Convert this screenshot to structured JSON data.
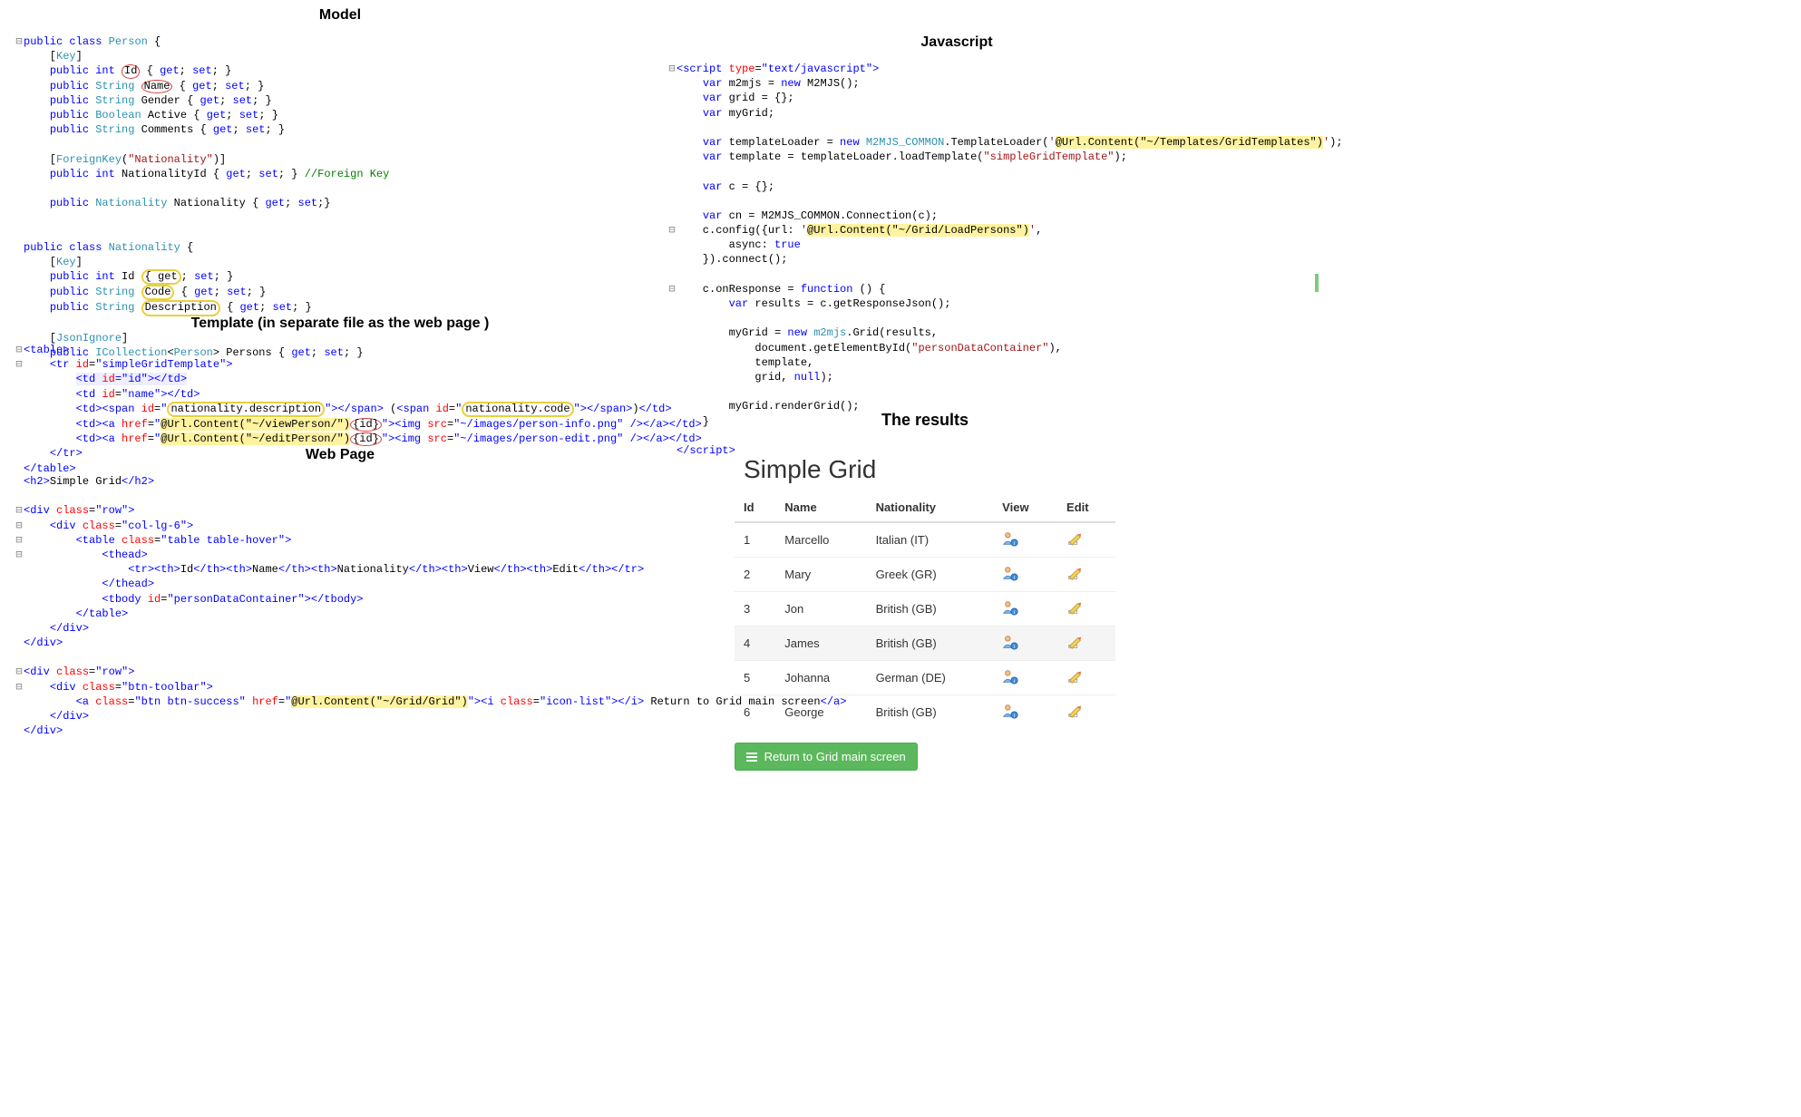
{
  "headings": {
    "model": "Model",
    "template": "Template (in separate file as the web page )",
    "webpage": "Web Page",
    "javascript": "Javascript",
    "results": "The results"
  },
  "model_code": {
    "person_class": "Person",
    "nationality_class": "Nationality",
    "key_attr": "[Key]",
    "fk_attr": "[ForeignKey(\"Nationality\")]",
    "jsonignore_attr": "[JsonIgnore]",
    "fk_comment": "//Foreign Key",
    "props_person": {
      "id": "Id",
      "name": "Name",
      "gender": "Gender",
      "active": "Active",
      "comments": "Comments",
      "nationalityid": "NationalityId",
      "nationality": "Nationality"
    },
    "props_nat": {
      "id": "Id",
      "code": "Code",
      "description": "Description",
      "persons": "Persons"
    }
  },
  "template_code": {
    "tr_id": "simpleGridTemplate",
    "td_id_id": "id",
    "td_id_name": "name",
    "span_natdesc": "nationality.description",
    "span_natcode": "nationality.code",
    "view_url": "@Url.Content(\"~/viewPerson/\"){id}",
    "edit_url": "@Url.Content(\"~/editPerson/\"){id}",
    "img_view": "~/images/person-info.png",
    "img_edit": "~/images/person-edit.png"
  },
  "webpage_code": {
    "h2_text": "Simple Grid",
    "row_class": "row",
    "col_class": "col-lg-6",
    "table_class": "table table-hover",
    "th_cols": [
      "Id",
      "Name",
      "Nationality",
      "View",
      "Edit"
    ],
    "tbody_id": "personDataContainer",
    "toolbar_class": "btn-toolbar",
    "btn_class": "btn btn-success",
    "btn_href": "@Url.Content(\"~/Grid/Grid\")",
    "icon_class": "icon-list",
    "btn_text": " Return to Grid main screen"
  },
  "js_code": {
    "script_type": "text/javascript",
    "m2mjs_new": "new M2MJS();",
    "tpl_url": "@Url.Content(\"~/Templates/GridTemplates\")",
    "tpl_name": "simpleGridTemplate",
    "conn_url": "@Url.Content(\"~/Grid/LoadPersons\")",
    "async_true": "true",
    "container_id": "personDataContainer",
    "m2mjs_grid": "m2mjs"
  },
  "results_grid": {
    "title": "Simple Grid",
    "columns": [
      "Id",
      "Name",
      "Nationality",
      "View",
      "Edit"
    ],
    "rows": [
      {
        "id": "1",
        "name": "Marcello",
        "nationality": "Italian (IT)"
      },
      {
        "id": "2",
        "name": "Mary",
        "nationality": "Greek (GR)"
      },
      {
        "id": "3",
        "name": "Jon",
        "nationality": "British (GB)"
      },
      {
        "id": "4",
        "name": "James",
        "nationality": "British (GB)",
        "hovered": true
      },
      {
        "id": "5",
        "name": "Johanna",
        "nationality": "German (DE)"
      },
      {
        "id": "6",
        "name": "George",
        "nationality": "British (GB)"
      }
    ],
    "return_button": "Return to Grid main screen"
  }
}
